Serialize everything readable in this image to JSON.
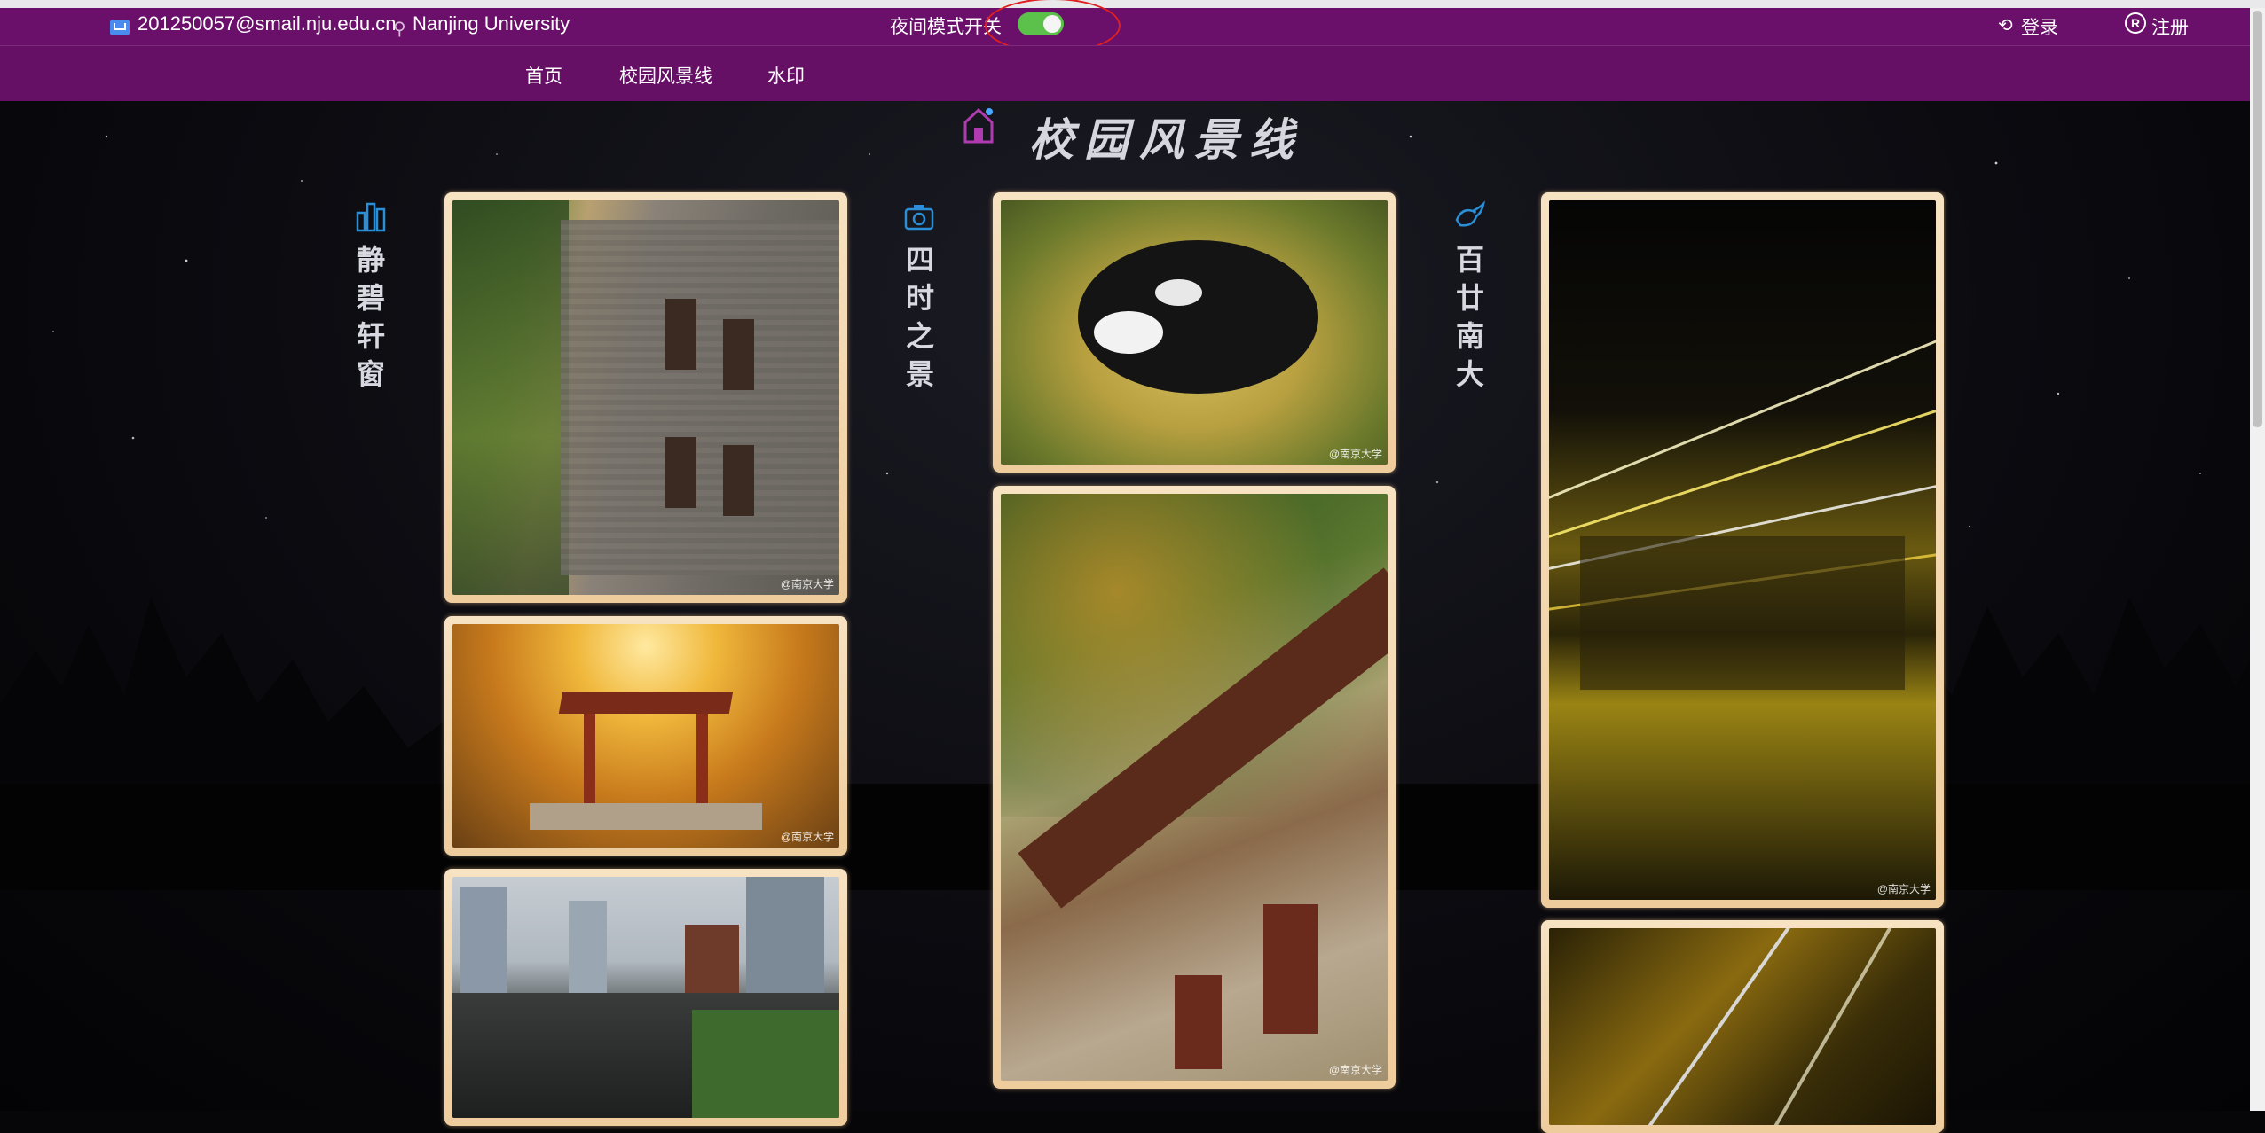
{
  "topbar": {
    "email": "201250057@smail.nju.edu.cn",
    "location": "Nanjing University",
    "night_mode_label": "夜间模式开关",
    "night_mode_on": true,
    "login_label": "登录",
    "register_label": "注册"
  },
  "nav": {
    "items": [
      "首页",
      "校园风景线",
      "水印"
    ]
  },
  "page_title": "校园风景线",
  "columns": [
    {
      "label_chars": [
        "静",
        "碧",
        "轩",
        "窗"
      ],
      "icon": "building-chart-icon"
    },
    {
      "label_chars": [
        "四",
        "时",
        "之",
        "景"
      ],
      "icon": "camera-icon"
    },
    {
      "label_chars": [
        "百",
        "廿",
        "南",
        "大"
      ],
      "icon": "bird-icon"
    }
  ],
  "photos": {
    "watermark": "@南京大学",
    "items": [
      {
        "name": "photo-old-building",
        "desc_icon": "image"
      },
      {
        "name": "photo-pavilion",
        "desc_icon": "image"
      },
      {
        "name": "photo-rooftops",
        "desc_icon": "image"
      },
      {
        "name": "photo-cat",
        "desc_icon": "image"
      },
      {
        "name": "photo-osmanthus",
        "desc_icon": "image"
      },
      {
        "name": "photo-light-show",
        "desc_icon": "image"
      },
      {
        "name": "photo-light-beams",
        "desc_icon": "image"
      }
    ]
  },
  "colors": {
    "header_purple": "#6a0f6a",
    "toggle_green": "#5cc14a",
    "frame_gold": "#efcc9c",
    "accent_blue": "#2a8fd6"
  }
}
